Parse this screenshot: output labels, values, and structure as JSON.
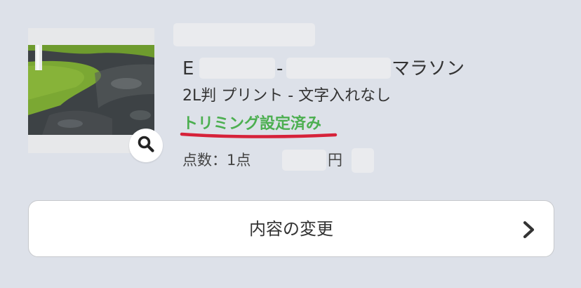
{
  "item": {
    "title_prefix": "E",
    "title_separator": "-",
    "title_suffix": "マラソン",
    "spec": "2L判 プリント - 文字入れなし",
    "trimming_status": "トリミング設定済み",
    "count_text": "点数：1点",
    "price_unit": "円"
  },
  "thumbnail": {
    "zoom_icon": "magnifier-icon"
  },
  "actions": {
    "change_label": "内容の変更",
    "change_icon": "chevron-right-icon"
  },
  "colors": {
    "trimming_status": "#4caf50",
    "annotation_underline": "#d6223a",
    "background": "#dde1e9"
  }
}
